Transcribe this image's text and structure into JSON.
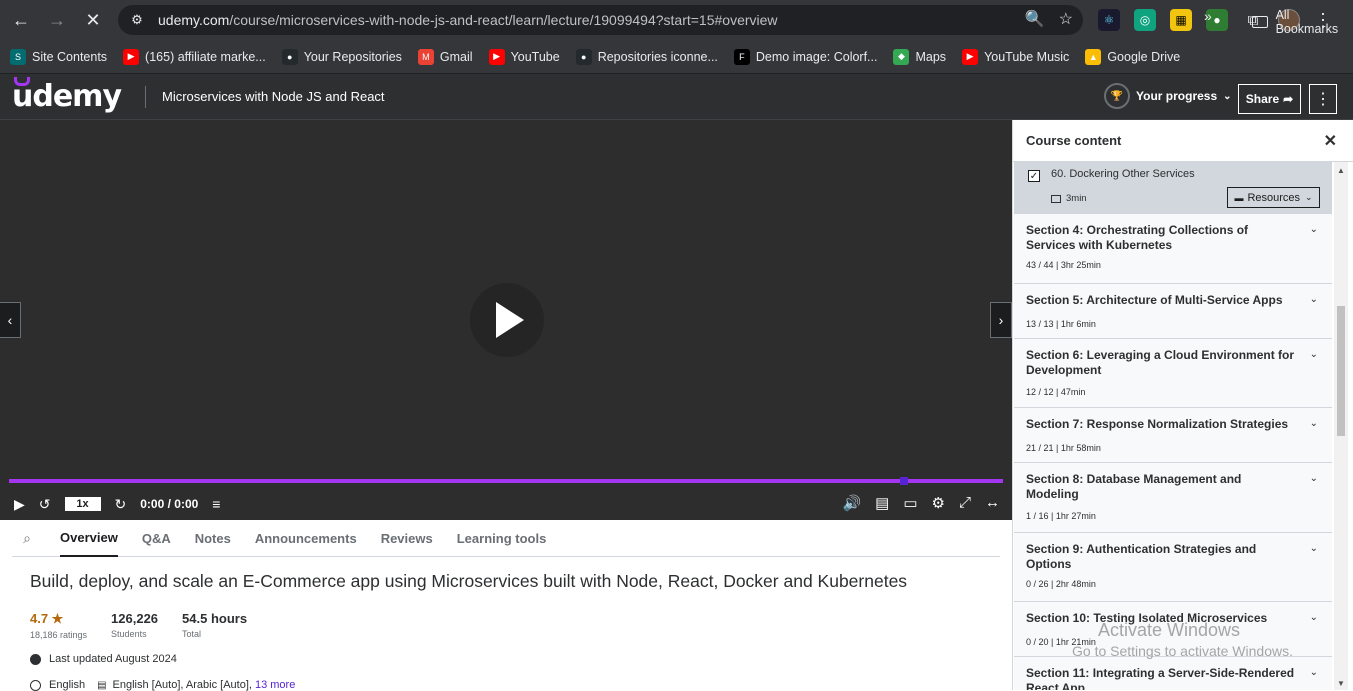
{
  "browser": {
    "url_host": "udemy.com",
    "url_path": "/course/microservices-with-node-js-and-react/learn/lecture/19099494?start=15#overview",
    "bookmarks": [
      {
        "label": "Site Contents",
        "color": "#036c70",
        "icon": "S"
      },
      {
        "label": "(165) affiliate marke...",
        "color": "#ff0000",
        "icon": "▶"
      },
      {
        "label": "Your Repositories",
        "color": "#24292e",
        "icon": "●"
      },
      {
        "label": "Gmail",
        "color": "#ea4335",
        "icon": "M"
      },
      {
        "label": "YouTube",
        "color": "#ff0000",
        "icon": "▶"
      },
      {
        "label": "Repositories iconne...",
        "color": "#24292e",
        "icon": "●"
      },
      {
        "label": "Demo image: Colorf...",
        "color": "#000000",
        "icon": "F"
      },
      {
        "label": "Maps",
        "color": "#34a853",
        "icon": "◆"
      },
      {
        "label": "YouTube Music",
        "color": "#ff0000",
        "icon": "▶"
      },
      {
        "label": "Google Drive",
        "color": "#fbbc04",
        "icon": "▲"
      }
    ],
    "all_bookmarks": "All Bookmarks"
  },
  "header": {
    "logo": "udemy",
    "course_title": "Microservices with Node JS and React",
    "progress_label": "Your progress",
    "share_label": "Share"
  },
  "player": {
    "speed": "1x",
    "time": "0:00 / 0:00",
    "progress_fraction": 0.9
  },
  "tabs": [
    "Overview",
    "Q&A",
    "Notes",
    "Announcements",
    "Reviews",
    "Learning tools"
  ],
  "overview": {
    "headline": "Build, deploy, and scale an E-Commerce app using Microservices built with Node, React, Docker and Kubernetes",
    "rating": "4.7 ★",
    "rating_label": "18,186 ratings",
    "students": "126,226",
    "students_label": "Students",
    "hours": "54.5 hours",
    "hours_label": "Total",
    "last_updated": "Last updated August 2024",
    "language": "English",
    "captions": "English [Auto], Arabic [Auto],",
    "captions_more": "13 more"
  },
  "sidebar": {
    "title": "Course content",
    "current_lecture": {
      "title": "60. Dockering Other Services",
      "duration": "3min",
      "resources": "Resources"
    },
    "sections": [
      {
        "title": "Section 4: Orchestrating Collections of Services with Kubernetes",
        "meta": "43 / 44 | 3hr 25min"
      },
      {
        "title": "Section 5: Architecture of Multi-Service Apps",
        "meta": "13 / 13 | 1hr 6min"
      },
      {
        "title": "Section 6: Leveraging a Cloud Environment for Development",
        "meta": "12 / 12 | 47min"
      },
      {
        "title": "Section 7: Response Normalization Strategies",
        "meta": "21 / 21 | 1hr 58min"
      },
      {
        "title": "Section 8: Database Management and Modeling",
        "meta": "1 / 16 | 1hr 27min"
      },
      {
        "title": "Section 9: Authentication Strategies and Options",
        "meta": "0 / 26 | 2hr 48min"
      },
      {
        "title": "Section 10: Testing Isolated Microservices",
        "meta": "0 / 20 | 1hr 21min"
      },
      {
        "title": "Section 11: Integrating a Server-Side-Rendered React App",
        "meta": ""
      }
    ]
  },
  "watermark": {
    "line1": "Activate Windows",
    "line2": "Go to Settings to activate Windows."
  }
}
